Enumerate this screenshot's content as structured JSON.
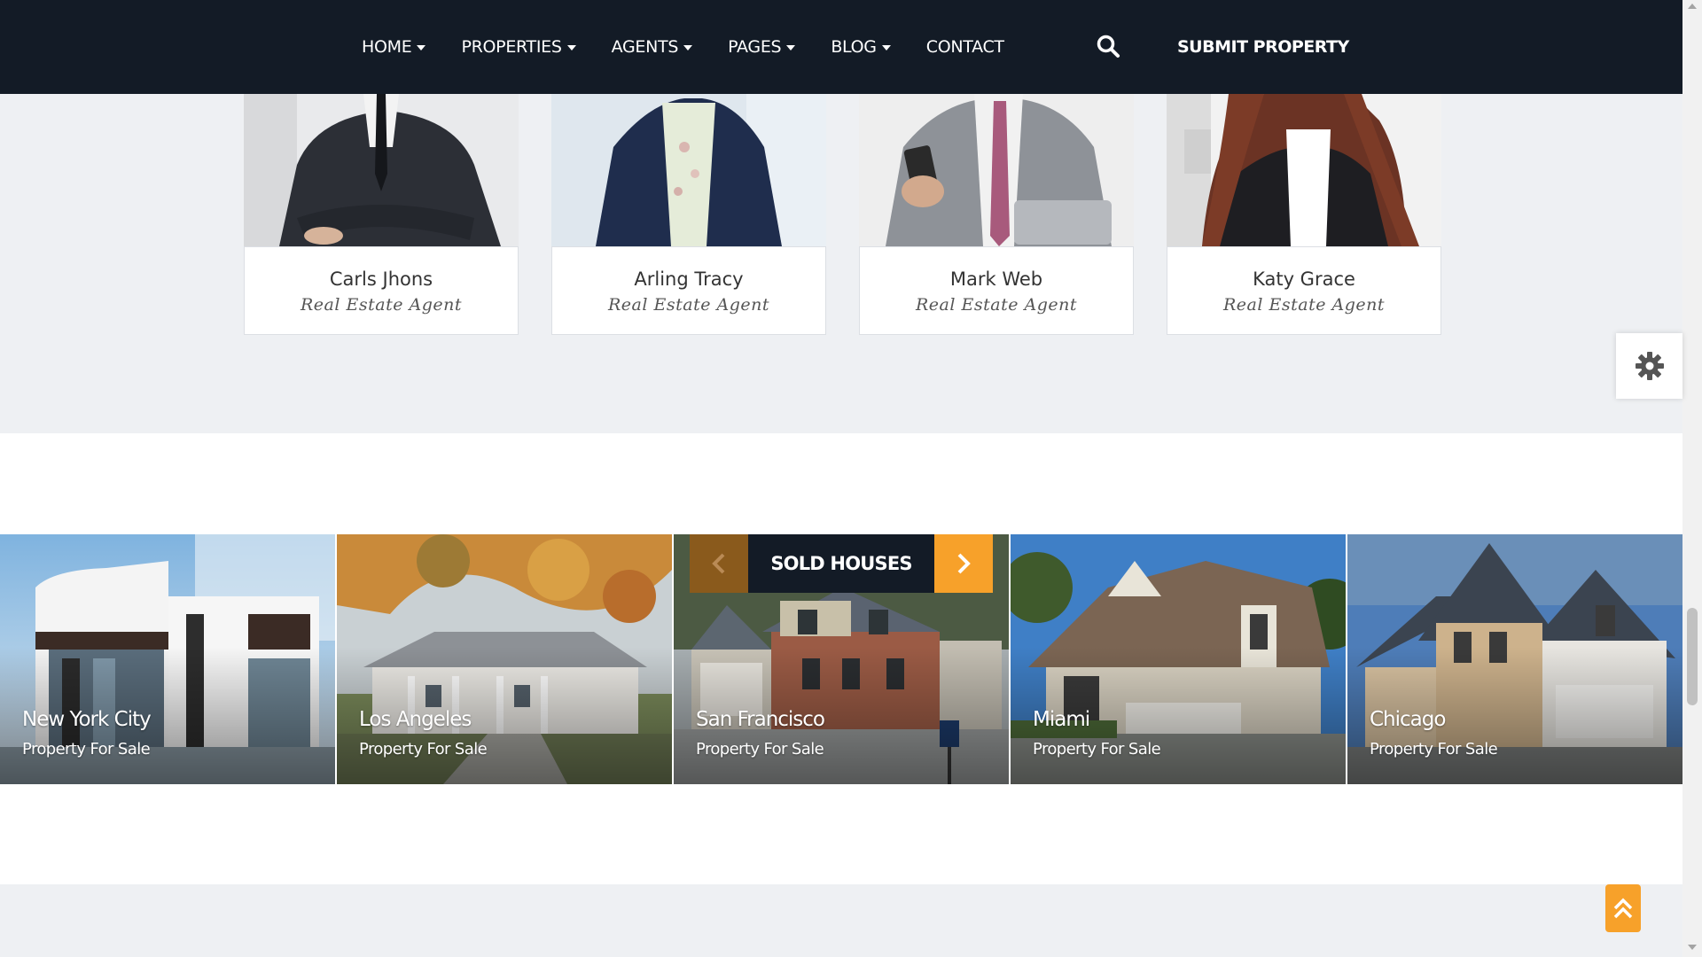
{
  "nav": {
    "items": [
      {
        "label": "HOME",
        "dropdown": true
      },
      {
        "label": "PROPERTIES",
        "dropdown": true
      },
      {
        "label": "AGENTS",
        "dropdown": true
      },
      {
        "label": "PAGES",
        "dropdown": true
      },
      {
        "label": "BLOG",
        "dropdown": true
      },
      {
        "label": "CONTACT",
        "dropdown": false
      }
    ],
    "search_icon": "search-icon",
    "submit_label": "SUBMIT PROPERTY"
  },
  "agents": [
    {
      "name": "Carls Jhons",
      "role": "Real Estate Agent"
    },
    {
      "name": "Arling Tracy",
      "role": "Real Estate Agent"
    },
    {
      "name": "Mark Web",
      "role": "Real Estate Agent"
    },
    {
      "name": "Katy Grace",
      "role": "Real Estate Agent"
    }
  ],
  "sold": {
    "title": "SOLD HOUSES",
    "prev_icon": "chevron-left-icon",
    "next_icon": "chevron-right-icon",
    "houses": [
      {
        "city": "New York City",
        "subtitle": "Property For Sale"
      },
      {
        "city": "Los Angeles",
        "subtitle": "Property For Sale"
      },
      {
        "city": "San Francisco",
        "subtitle": "Property For Sale"
      },
      {
        "city": "Miami",
        "subtitle": "Property For Sale"
      },
      {
        "city": "Chicago",
        "subtitle": "Property For Sale"
      }
    ]
  },
  "settings_icon": "gear-icon",
  "scroll_top_icon": "double-chevron-up-icon",
  "colors": {
    "nav_bg": "#131b26",
    "accent": "#f7a12a",
    "accent_dark": "#8a5a1c",
    "section_bg": "#eef0f3"
  }
}
